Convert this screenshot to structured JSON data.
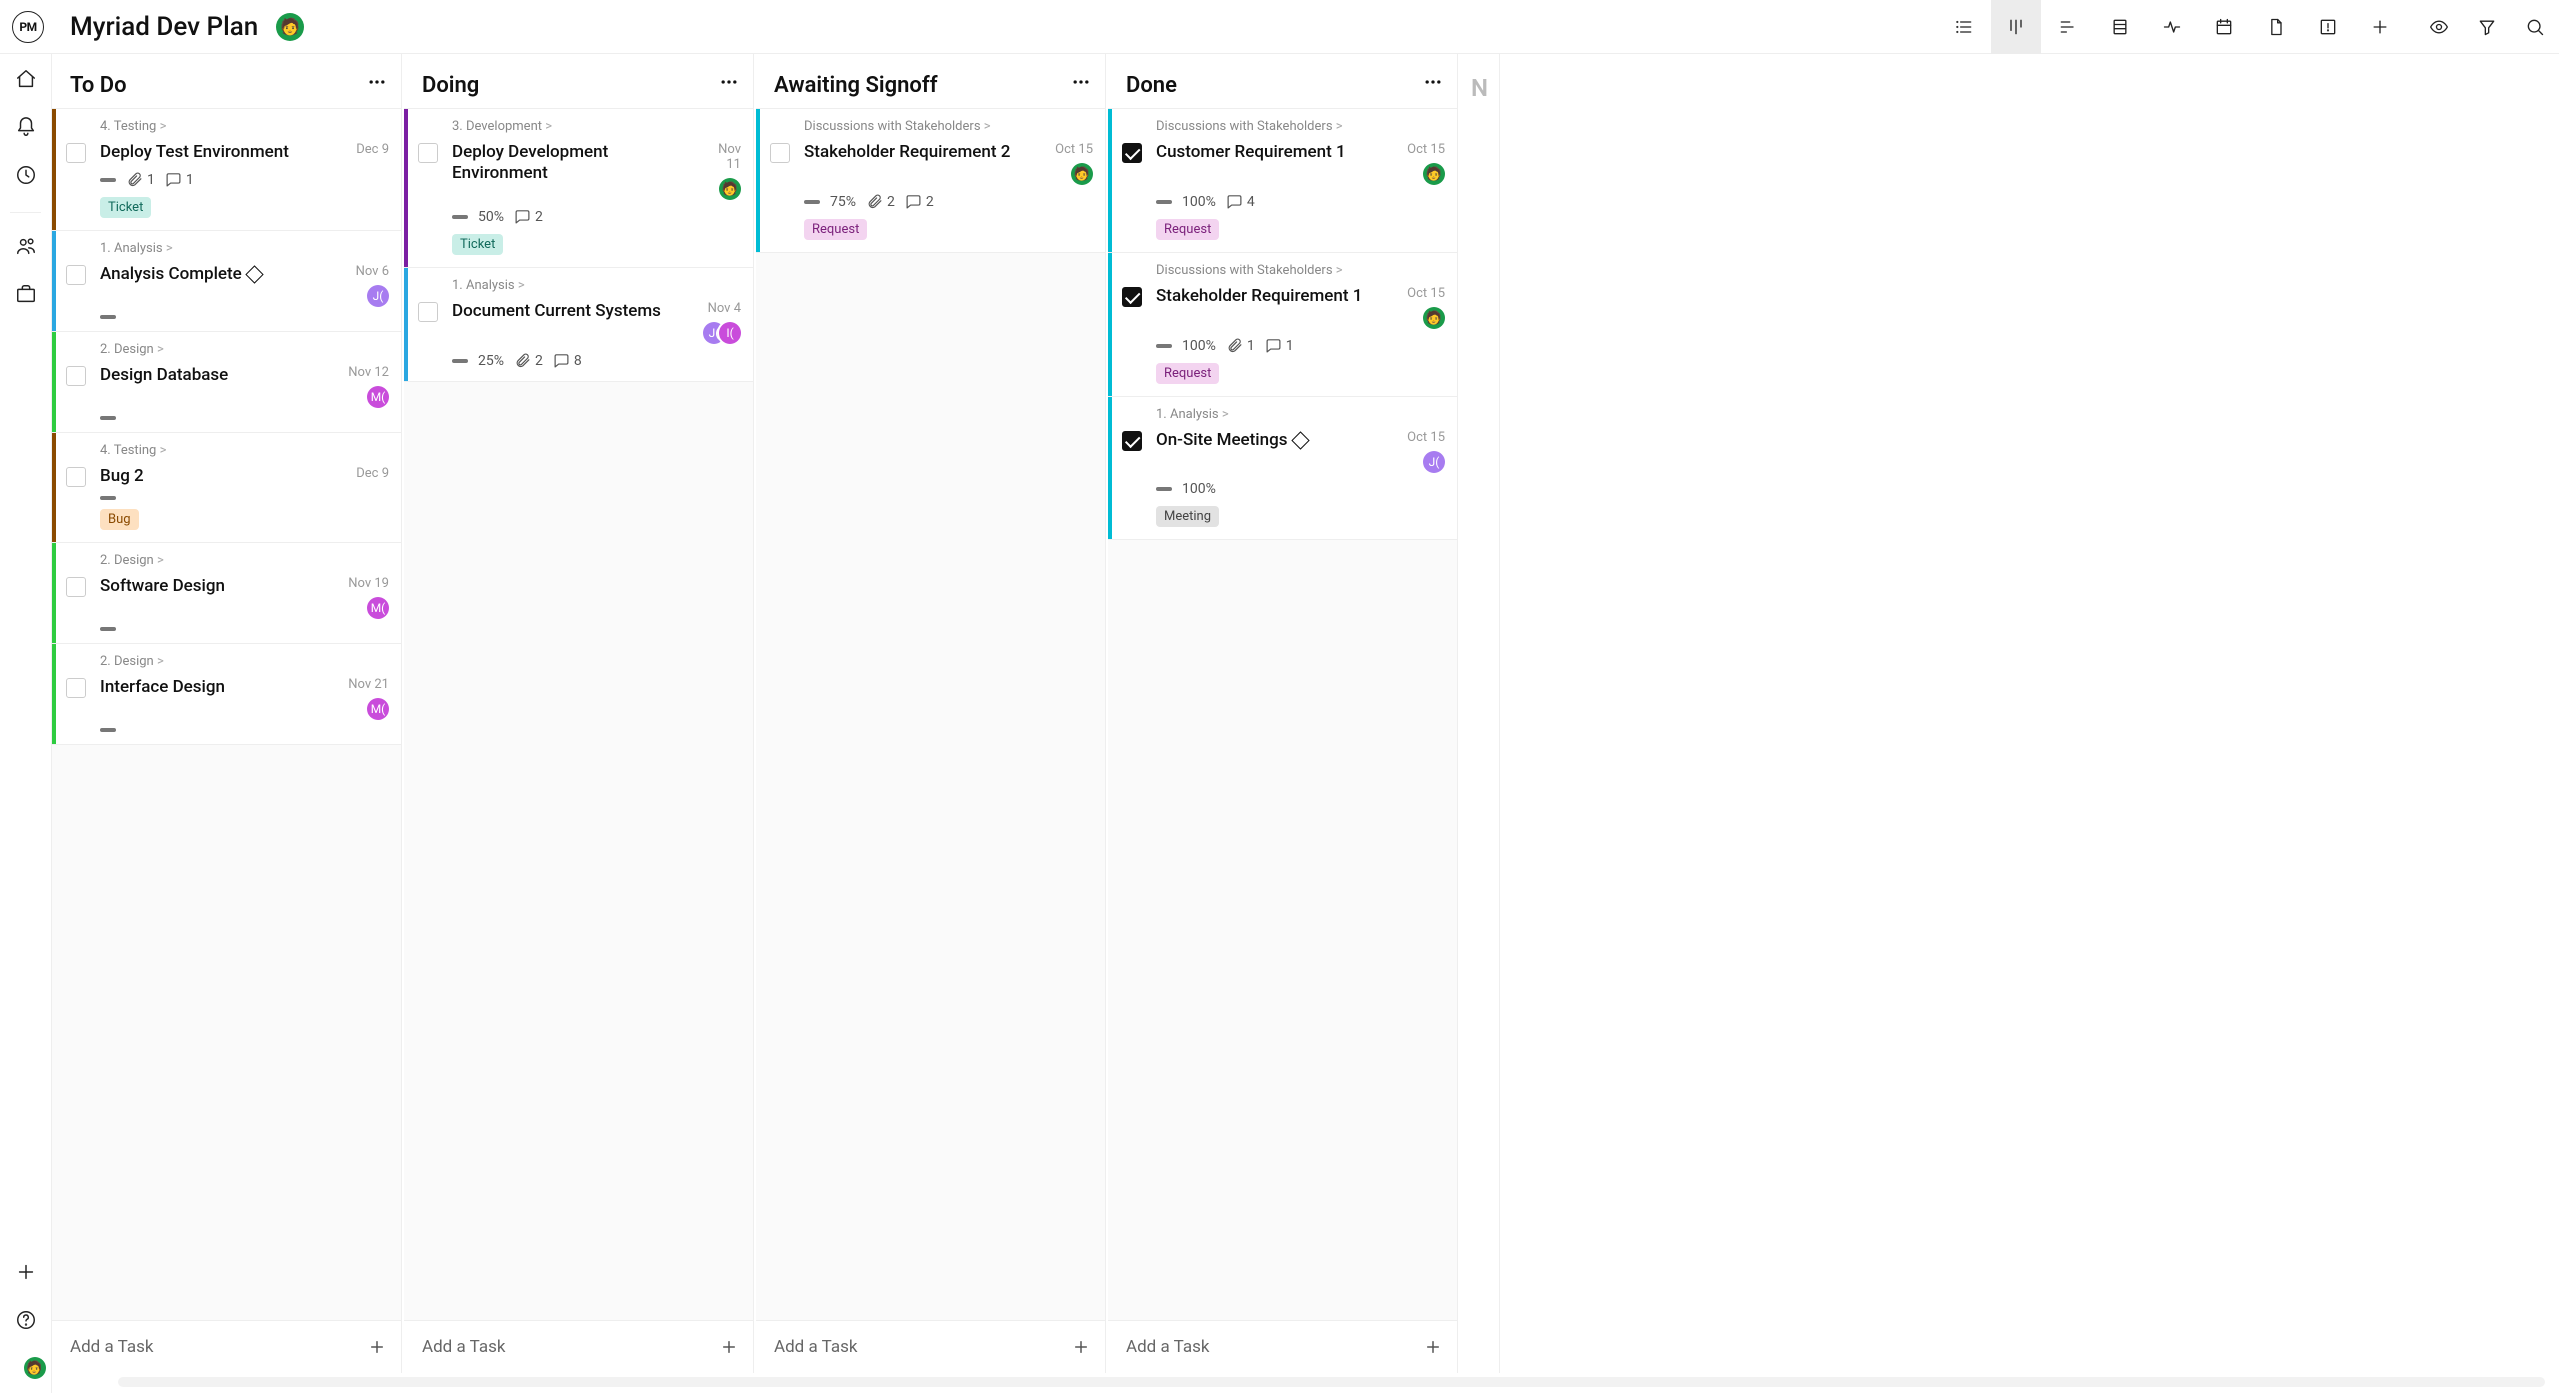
{
  "project": {
    "title": "Myriad Dev Plan"
  },
  "addTaskLabel": "Add a Task",
  "partialColHint": "N",
  "columns": [
    {
      "title": "To Do",
      "cards": [
        {
          "stripe": "#8a4a00",
          "breadcrumb": "4. Testing",
          "title": "Deploy Test Environment",
          "date": "Dec 9",
          "attachments": 1,
          "comments": 1,
          "tag": "Ticket",
          "tagClass": "ticket",
          "avatars": []
        },
        {
          "stripe": "#2aa7e1",
          "breadcrumb": "1. Analysis",
          "title": "Analysis Complete",
          "diamond": true,
          "date": "Nov 6",
          "avatars": [
            {
              "cls": "purple",
              "txt": "J("
            }
          ]
        },
        {
          "stripe": "#2ecc40",
          "breadcrumb": "2. Design",
          "title": "Design Database",
          "date": "Nov 12",
          "avatars": [
            {
              "cls": "magenta",
              "txt": "M("
            }
          ]
        },
        {
          "stripe": "#8a4a00",
          "breadcrumb": "4. Testing",
          "title": "Bug 2",
          "date": "Dec 9",
          "tag": "Bug",
          "tagClass": "bug",
          "avatars": []
        },
        {
          "stripe": "#2ecc40",
          "breadcrumb": "2. Design",
          "title": "Software Design",
          "date": "Nov 19",
          "avatars": [
            {
              "cls": "magenta",
              "txt": "M("
            }
          ]
        },
        {
          "stripe": "#2ecc40",
          "breadcrumb": "2. Design",
          "title": "Interface Design",
          "date": "Nov 21",
          "avatars": [
            {
              "cls": "magenta",
              "txt": "M("
            }
          ]
        }
      ]
    },
    {
      "title": "Doing",
      "cards": [
        {
          "stripe": "#7a1fa2",
          "breadcrumb": "3. Development",
          "title": "Deploy Development Environment",
          "date": "Nov 11",
          "percent": "50%",
          "comments": 2,
          "tag": "Ticket",
          "tagClass": "ticket",
          "avatars": [
            {
              "cls": "green avatar-face",
              "txt": ""
            }
          ]
        },
        {
          "stripe": "#2aa7e1",
          "breadcrumb": "1. Analysis",
          "title": "Document Current Systems",
          "date": "Nov 4",
          "percent": "25%",
          "attachments": 2,
          "comments": 8,
          "avatars": [
            {
              "cls": "purple",
              "txt": "J("
            },
            {
              "cls": "magenta",
              "txt": "I("
            }
          ]
        }
      ]
    },
    {
      "title": "Awaiting Signoff",
      "cards": [
        {
          "stripe": "#00bcd4",
          "breadcrumb": "Discussions with Stakeholders",
          "title": "Stakeholder Requirement 2",
          "date": "Oct 15",
          "percent": "75%",
          "attachments": 2,
          "comments": 2,
          "tag": "Request",
          "tagClass": "request",
          "avatars": [
            {
              "cls": "green avatar-face",
              "txt": ""
            }
          ]
        }
      ]
    },
    {
      "title": "Done",
      "cards": [
        {
          "done": true,
          "stripe": "#00bcd4",
          "breadcrumb": "Discussions with Stakeholders",
          "title": "Customer Requirement 1",
          "date": "Oct 15",
          "percent": "100%",
          "comments": 4,
          "tag": "Request",
          "tagClass": "request",
          "avatars": [
            {
              "cls": "green avatar-face",
              "txt": ""
            }
          ]
        },
        {
          "done": true,
          "stripe": "#00bcd4",
          "breadcrumb": "Discussions with Stakeholders",
          "title": "Stakeholder Requirement 1",
          "date": "Oct 15",
          "percent": "100%",
          "attachments": 1,
          "comments": 1,
          "tag": "Request",
          "tagClass": "request",
          "avatars": [
            {
              "cls": "green avatar-face",
              "txt": ""
            }
          ]
        },
        {
          "done": true,
          "stripe": "#00bcd4",
          "breadcrumb": "1. Analysis",
          "title": "On-Site Meetings",
          "diamond": true,
          "date": "Oct 15",
          "percent": "100%",
          "tag": "Meeting",
          "tagClass": "meeting",
          "avatars": [
            {
              "cls": "purple",
              "txt": "J("
            }
          ]
        }
      ]
    }
  ]
}
